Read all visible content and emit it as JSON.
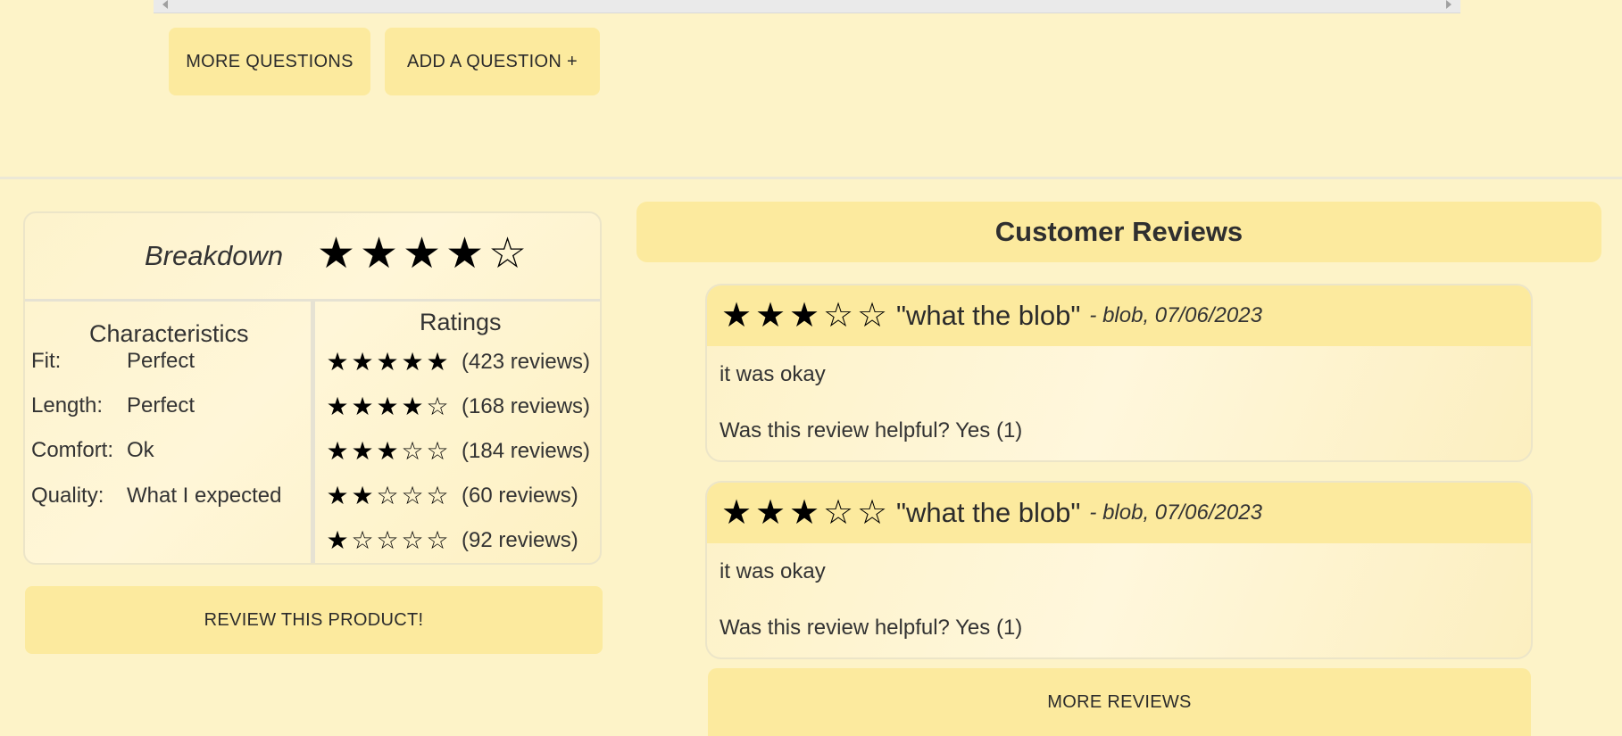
{
  "questions": {
    "more_label": "MORE QUESTIONS",
    "add_label": "ADD A QUESTION +"
  },
  "breakdown": {
    "title": "Breakdown",
    "average_stars": 4,
    "characteristics_title": "Characteristics",
    "characteristics": [
      {
        "label": "Fit:",
        "value": "Perfect"
      },
      {
        "label": "Length:",
        "value": "Perfect"
      },
      {
        "label": "Comfort:",
        "value": "Ok"
      },
      {
        "label": "Quality:",
        "value": "What I expected"
      }
    ],
    "ratings_title": "Ratings",
    "ratings": [
      {
        "stars": 5,
        "count_label": "(423 reviews)"
      },
      {
        "stars": 4,
        "count_label": "(168 reviews)"
      },
      {
        "stars": 3,
        "count_label": "(184 reviews)"
      },
      {
        "stars": 2,
        "count_label": "(60 reviews)"
      },
      {
        "stars": 1,
        "count_label": "(92 reviews)"
      }
    ],
    "review_button_label": "REVIEW THIS PRODUCT!"
  },
  "reviews": {
    "header": "Customer Reviews",
    "items": [
      {
        "stars": 3,
        "title": "\"what the blob\"",
        "meta": "- blob, 07/06/2023",
        "body": "it was okay",
        "helpful_prefix": "Was this review helpful?",
        "helpful_yes": "Yes (1)"
      },
      {
        "stars": 3,
        "title": "\"what the blob\"",
        "meta": "- blob, 07/06/2023",
        "body": "it was okay",
        "helpful_prefix": "Was this review helpful?",
        "helpful_yes": "Yes (1)"
      }
    ],
    "more_label": "MORE REVIEWS"
  },
  "icons": {
    "star_filled": "star-filled-icon",
    "star_empty": "star-empty-icon"
  }
}
